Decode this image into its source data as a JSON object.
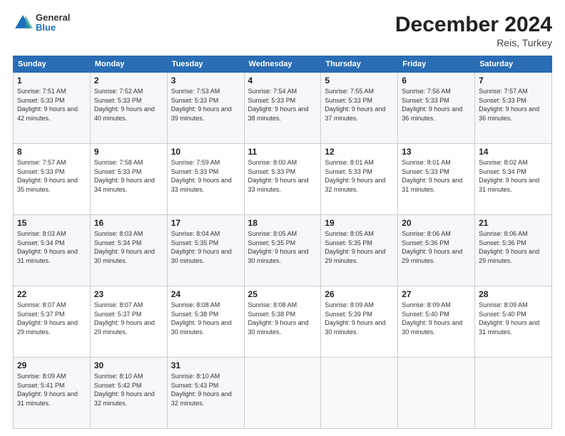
{
  "header": {
    "logo_general": "General",
    "logo_blue": "Blue",
    "month_title": "December 2024",
    "location": "Reis, Turkey"
  },
  "days_of_week": [
    "Sunday",
    "Monday",
    "Tuesday",
    "Wednesday",
    "Thursday",
    "Friday",
    "Saturday"
  ],
  "weeks": [
    [
      {
        "day": "1",
        "sunrise": "Sunrise: 7:51 AM",
        "sunset": "Sunset: 5:33 PM",
        "daylight": "Daylight: 9 hours and 42 minutes."
      },
      {
        "day": "2",
        "sunrise": "Sunrise: 7:52 AM",
        "sunset": "Sunset: 5:33 PM",
        "daylight": "Daylight: 9 hours and 40 minutes."
      },
      {
        "day": "3",
        "sunrise": "Sunrise: 7:53 AM",
        "sunset": "Sunset: 5:33 PM",
        "daylight": "Daylight: 9 hours and 39 minutes."
      },
      {
        "day": "4",
        "sunrise": "Sunrise: 7:54 AM",
        "sunset": "Sunset: 5:33 PM",
        "daylight": "Daylight: 9 hours and 38 minutes."
      },
      {
        "day": "5",
        "sunrise": "Sunrise: 7:55 AM",
        "sunset": "Sunset: 5:33 PM",
        "daylight": "Daylight: 9 hours and 37 minutes."
      },
      {
        "day": "6",
        "sunrise": "Sunrise: 7:56 AM",
        "sunset": "Sunset: 5:33 PM",
        "daylight": "Daylight: 9 hours and 36 minutes."
      },
      {
        "day": "7",
        "sunrise": "Sunrise: 7:57 AM",
        "sunset": "Sunset: 5:33 PM",
        "daylight": "Daylight: 9 hours and 36 minutes."
      }
    ],
    [
      {
        "day": "8",
        "sunrise": "Sunrise: 7:57 AM",
        "sunset": "Sunset: 5:33 PM",
        "daylight": "Daylight: 9 hours and 35 minutes."
      },
      {
        "day": "9",
        "sunrise": "Sunrise: 7:58 AM",
        "sunset": "Sunset: 5:33 PM",
        "daylight": "Daylight: 9 hours and 34 minutes."
      },
      {
        "day": "10",
        "sunrise": "Sunrise: 7:59 AM",
        "sunset": "Sunset: 5:33 PM",
        "daylight": "Daylight: 9 hours and 33 minutes."
      },
      {
        "day": "11",
        "sunrise": "Sunrise: 8:00 AM",
        "sunset": "Sunset: 5:33 PM",
        "daylight": "Daylight: 9 hours and 33 minutes."
      },
      {
        "day": "12",
        "sunrise": "Sunrise: 8:01 AM",
        "sunset": "Sunset: 5:33 PM",
        "daylight": "Daylight: 9 hours and 32 minutes."
      },
      {
        "day": "13",
        "sunrise": "Sunrise: 8:01 AM",
        "sunset": "Sunset: 5:33 PM",
        "daylight": "Daylight: 9 hours and 31 minutes."
      },
      {
        "day": "14",
        "sunrise": "Sunrise: 8:02 AM",
        "sunset": "Sunset: 5:34 PM",
        "daylight": "Daylight: 9 hours and 31 minutes."
      }
    ],
    [
      {
        "day": "15",
        "sunrise": "Sunrise: 8:03 AM",
        "sunset": "Sunset: 5:34 PM",
        "daylight": "Daylight: 9 hours and 31 minutes."
      },
      {
        "day": "16",
        "sunrise": "Sunrise: 8:03 AM",
        "sunset": "Sunset: 5:34 PM",
        "daylight": "Daylight: 9 hours and 30 minutes."
      },
      {
        "day": "17",
        "sunrise": "Sunrise: 8:04 AM",
        "sunset": "Sunset: 5:35 PM",
        "daylight": "Daylight: 9 hours and 30 minutes."
      },
      {
        "day": "18",
        "sunrise": "Sunrise: 8:05 AM",
        "sunset": "Sunset: 5:35 PM",
        "daylight": "Daylight: 9 hours and 30 minutes."
      },
      {
        "day": "19",
        "sunrise": "Sunrise: 8:05 AM",
        "sunset": "Sunset: 5:35 PM",
        "daylight": "Daylight: 9 hours and 29 minutes."
      },
      {
        "day": "20",
        "sunrise": "Sunrise: 8:06 AM",
        "sunset": "Sunset: 5:36 PM",
        "daylight": "Daylight: 9 hours and 29 minutes."
      },
      {
        "day": "21",
        "sunrise": "Sunrise: 8:06 AM",
        "sunset": "Sunset: 5:36 PM",
        "daylight": "Daylight: 9 hours and 29 minutes."
      }
    ],
    [
      {
        "day": "22",
        "sunrise": "Sunrise: 8:07 AM",
        "sunset": "Sunset: 5:37 PM",
        "daylight": "Daylight: 9 hours and 29 minutes."
      },
      {
        "day": "23",
        "sunrise": "Sunrise: 8:07 AM",
        "sunset": "Sunset: 5:37 PM",
        "daylight": "Daylight: 9 hours and 29 minutes."
      },
      {
        "day": "24",
        "sunrise": "Sunrise: 8:08 AM",
        "sunset": "Sunset: 5:38 PM",
        "daylight": "Daylight: 9 hours and 30 minutes."
      },
      {
        "day": "25",
        "sunrise": "Sunrise: 8:08 AM",
        "sunset": "Sunset: 5:38 PM",
        "daylight": "Daylight: 9 hours and 30 minutes."
      },
      {
        "day": "26",
        "sunrise": "Sunrise: 8:09 AM",
        "sunset": "Sunset: 5:39 PM",
        "daylight": "Daylight: 9 hours and 30 minutes."
      },
      {
        "day": "27",
        "sunrise": "Sunrise: 8:09 AM",
        "sunset": "Sunset: 5:40 PM",
        "daylight": "Daylight: 9 hours and 30 minutes."
      },
      {
        "day": "28",
        "sunrise": "Sunrise: 8:09 AM",
        "sunset": "Sunset: 5:40 PM",
        "daylight": "Daylight: 9 hours and 31 minutes."
      }
    ],
    [
      {
        "day": "29",
        "sunrise": "Sunrise: 8:09 AM",
        "sunset": "Sunset: 5:41 PM",
        "daylight": "Daylight: 9 hours and 31 minutes."
      },
      {
        "day": "30",
        "sunrise": "Sunrise: 8:10 AM",
        "sunset": "Sunset: 5:42 PM",
        "daylight": "Daylight: 9 hours and 32 minutes."
      },
      {
        "day": "31",
        "sunrise": "Sunrise: 8:10 AM",
        "sunset": "Sunset: 5:43 PM",
        "daylight": "Daylight: 9 hours and 32 minutes."
      },
      null,
      null,
      null,
      null
    ]
  ]
}
